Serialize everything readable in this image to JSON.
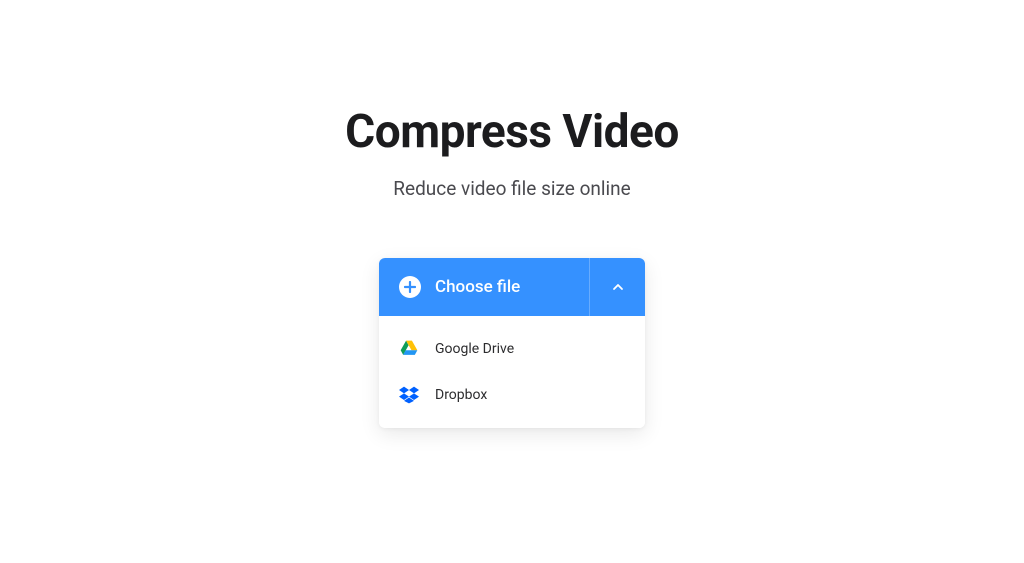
{
  "header": {
    "title": "Compress Video",
    "subtitle": "Reduce video file size online"
  },
  "upload": {
    "choose_file_label": "Choose file",
    "dropdown": {
      "items": [
        {
          "label": "Google Drive"
        },
        {
          "label": "Dropbox"
        }
      ]
    }
  },
  "colors": {
    "primary": "#3591ff",
    "text_dark": "#1c1c1e",
    "text_muted": "#4a4a4f"
  }
}
